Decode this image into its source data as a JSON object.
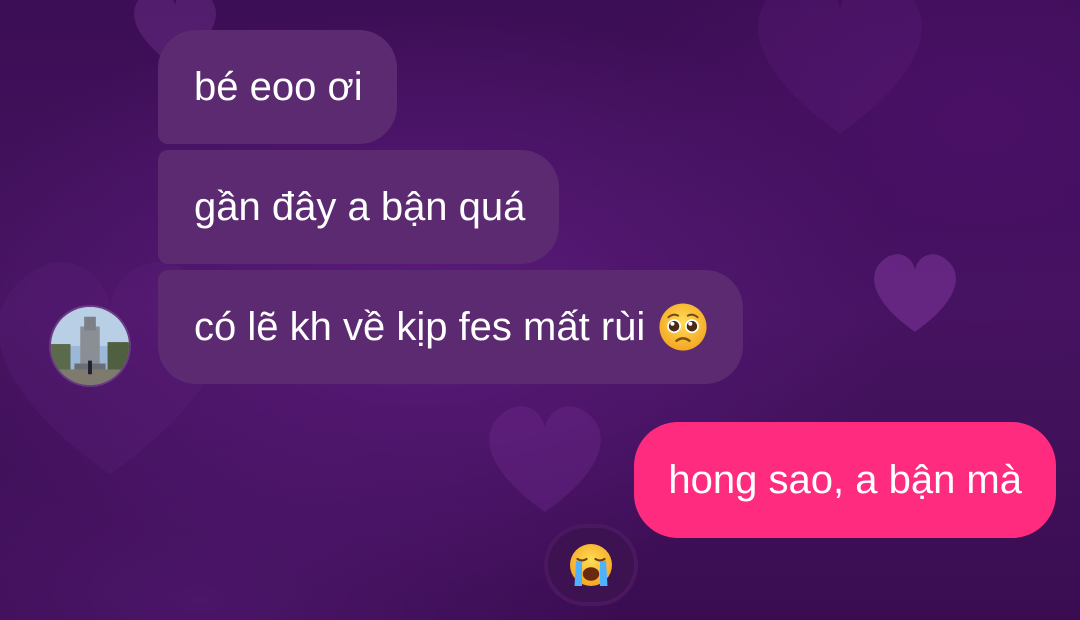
{
  "messages": {
    "received": [
      {
        "text": "bé eoo ơi"
      },
      {
        "text": "gần đây a bận quá"
      },
      {
        "text": "có lẽ kh về kịp fes mất rùi",
        "emoji": "pleading-face"
      }
    ],
    "sent": [
      {
        "text": "hong sao, a bận mà",
        "reaction": "loudly-crying-face"
      }
    ]
  },
  "colors": {
    "received_bubble": "#5b2a71",
    "sent_bubble": "#ff2b7f",
    "background": "#3a0d52"
  },
  "icons": {
    "avatar": "contact-avatar",
    "inline_emoji": "pleading-face-emoji",
    "reaction_emoji": "loudly-crying-face-emoji"
  }
}
